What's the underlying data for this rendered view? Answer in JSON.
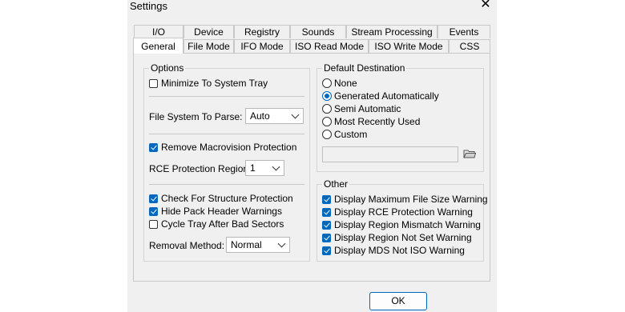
{
  "window": {
    "title": "Settings"
  },
  "tabs_row1": [
    "I/O",
    "Device",
    "Registry",
    "Sounds",
    "Stream Processing",
    "Events"
  ],
  "tabs_row2": [
    "General",
    "File Mode",
    "IFO Mode",
    "ISO Read Mode",
    "ISO Write Mode",
    "CSS"
  ],
  "active_tab": "General",
  "options": {
    "title": "Options",
    "minimize": {
      "label": "Minimize To System Tray",
      "checked": false
    },
    "fs_label": "File System To Parse:",
    "fs_value": "Auto",
    "remove_macrovision": {
      "label": "Remove Macrovision Protection",
      "checked": true
    },
    "rce_label": "RCE Protection Region:",
    "rce_value": "1",
    "check_structure": {
      "label": "Check For Structure Protection",
      "checked": true
    },
    "hide_pack": {
      "label": "Hide Pack Header Warnings",
      "checked": true
    },
    "cycle_tray": {
      "label": "Cycle Tray After Bad Sectors",
      "checked": false
    },
    "removal_label": "Removal Method:",
    "removal_value": "Normal"
  },
  "default_destination": {
    "title": "Default Destination",
    "radios": [
      "None",
      "Generated Automatically",
      "Semi Automatic",
      "Most Recently Used",
      "Custom"
    ],
    "selected": "Generated Automatically",
    "path_value": ""
  },
  "other": {
    "title": "Other",
    "items": [
      "Display Maximum File Size Warning",
      "Display RCE Protection Warning",
      "Display Region Mismatch Warning",
      "Display Region Not Set Warning",
      "Display MDS Not ISO Warning"
    ]
  },
  "buttons": {
    "ok": "OK"
  },
  "icons": {
    "close": "close-icon",
    "folder": "folder-icon"
  },
  "colors": {
    "accent": "#0067c0",
    "background": "#f0f0f0"
  }
}
